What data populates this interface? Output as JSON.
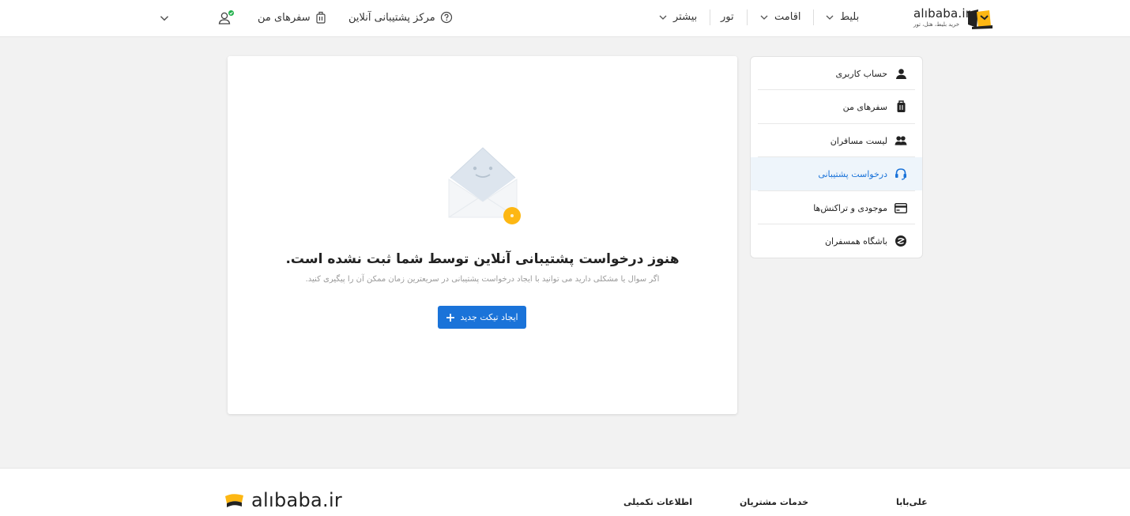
{
  "header": {
    "logo_text": "alıbaba.ir",
    "logo_sub": "خرید بلیط، هتل، تور",
    "nav": {
      "ticket": "بلیط",
      "stay": "اقامت",
      "tour": "تور",
      "more": "بیشتر",
      "support": "مرکز پشتیبانی آنلاین",
      "trips": "سفرهای من"
    }
  },
  "main": {
    "title": "هنوز درخواست پشتیبانی آنلاین توسط شما ثبت نشده است.",
    "description": "اگر سوال یا مشکلی دارید می توانید با ایجاد درخواست پشتیبانی در سریعترین زمان ممکن آن را پیگیری کنید.",
    "create_button": "ایجاد تیکت جدید"
  },
  "sidebar": {
    "items": [
      {
        "label": "حساب کاربری",
        "icon": "user-icon"
      },
      {
        "label": "سفرهای من",
        "icon": "luggage-icon"
      },
      {
        "label": "لیست مسافران",
        "icon": "users-icon"
      },
      {
        "label": "درخواست پشتیبانی",
        "icon": "headset-icon",
        "active": true
      },
      {
        "label": "موجودی و تراکنش‌ها",
        "icon": "card-icon"
      },
      {
        "label": "باشگاه همسفران",
        "icon": "club-icon"
      }
    ]
  },
  "footer": {
    "logo_text": "alıbaba.ir",
    "col1": "علی‌بابا",
    "col2": "خدمات مشتریان",
    "col3": "اطلاعات تکمیلی"
  },
  "colors": {
    "accent": "#1a73d9",
    "brand_yellow": "#fdb713",
    "active_bg": "#eef5fb",
    "online_badge": "#22b14c"
  }
}
